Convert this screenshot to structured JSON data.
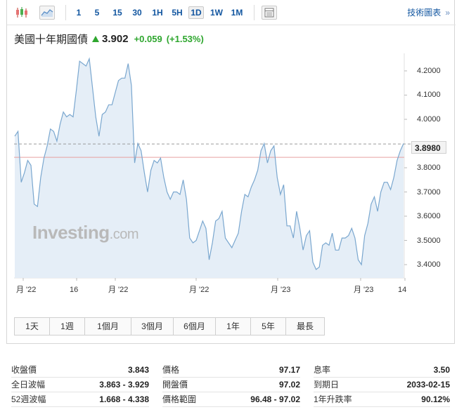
{
  "toolbar": {
    "periods": [
      "1",
      "5",
      "15",
      "30",
      "1H",
      "5H",
      "1D",
      "1W",
      "1M"
    ],
    "active_period": "1D",
    "tech_chart_link": "技術圖表",
    "tech_chart_arrows": "»",
    "icons": [
      "candlestick-icon",
      "area-chart-icon",
      "table-icon"
    ]
  },
  "title": {
    "name": "美國十年期國債",
    "price": "3.902",
    "change": "+0.059",
    "change_pct": "(+1.53%)",
    "direction": "up"
  },
  "chart_data": {
    "type": "area",
    "title": "",
    "xlabel": "",
    "ylabel": "",
    "x_tick_labels": [
      "月 '22",
      "16",
      "月 '22",
      "月 '22",
      "月 '23",
      "月 '23",
      "14"
    ],
    "y_tick_labels": [
      "4.2000",
      "4.1000",
      "4.0000",
      "3.8000",
      "3.7000",
      "3.6000",
      "3.5000",
      "3.4000"
    ],
    "ylim": [
      3.345,
      4.255
    ],
    "current_price_label": "3.8980",
    "current_price_line": 3.898,
    "reference_line": 3.843,
    "grid": false,
    "colors": {
      "line": "#7aa7cf",
      "fill": "#e5eef7",
      "reference": "#e8a0a0",
      "current": "#9a9a9a"
    },
    "series": [
      {
        "values": [
          3.93,
          3.95,
          3.74,
          3.78,
          3.83,
          3.81,
          3.65,
          3.64,
          3.76,
          3.84,
          3.89,
          3.96,
          3.95,
          3.91,
          3.98,
          4.03,
          4.01,
          4.02,
          4.01,
          4.12,
          4.24,
          4.23,
          4.22,
          4.25,
          4.13,
          4.01,
          3.93,
          4.02,
          4.03,
          4.06,
          4.06,
          4.11,
          4.16,
          4.17,
          4.17,
          4.23,
          4.14,
          3.82,
          3.9,
          3.87,
          3.78,
          3.7,
          3.79,
          3.83,
          3.82,
          3.84,
          3.76,
          3.7,
          3.67,
          3.7,
          3.7,
          3.69,
          3.75,
          3.67,
          3.51,
          3.49,
          3.5,
          3.54,
          3.58,
          3.55,
          3.42,
          3.49,
          3.58,
          3.59,
          3.62,
          3.51,
          3.49,
          3.47,
          3.5,
          3.53,
          3.62,
          3.69,
          3.68,
          3.72,
          3.75,
          3.79,
          3.87,
          3.9,
          3.82,
          3.87,
          3.89,
          3.76,
          3.69,
          3.73,
          3.56,
          3.56,
          3.51,
          3.62,
          3.55,
          3.46,
          3.52,
          3.54,
          3.41,
          3.38,
          3.39,
          3.48,
          3.49,
          3.48,
          3.53,
          3.46,
          3.46,
          3.51,
          3.51,
          3.52,
          3.55,
          3.51,
          3.42,
          3.4,
          3.52,
          3.57,
          3.65,
          3.68,
          3.62,
          3.7,
          3.74,
          3.74,
          3.71,
          3.76,
          3.83,
          3.87,
          3.9
        ]
      }
    ]
  },
  "watermark": {
    "brand": "Investing",
    "suffix": ".com"
  },
  "range_buttons": [
    "1天",
    "1週",
    "1個月",
    "3個月",
    "6個月",
    "1年",
    "5年",
    "最長"
  ],
  "stats": {
    "col1": [
      {
        "label": "收盤價",
        "value": "3.843"
      },
      {
        "label": "全日波幅",
        "value": "3.863 - 3.929"
      },
      {
        "label": "52週波幅",
        "value": "1.668 - 4.338"
      }
    ],
    "col2": [
      {
        "label": "價格",
        "value": "97.17"
      },
      {
        "label": "開盤價",
        "value": "97.02"
      },
      {
        "label": "價格範圍",
        "value": "96.48 - 97.02"
      }
    ],
    "col3": [
      {
        "label": "息率",
        "value": "3.50"
      },
      {
        "label": "到期日",
        "value": "2033-02-15"
      },
      {
        "label": "1年升跌率",
        "value": "90.12%"
      }
    ]
  }
}
